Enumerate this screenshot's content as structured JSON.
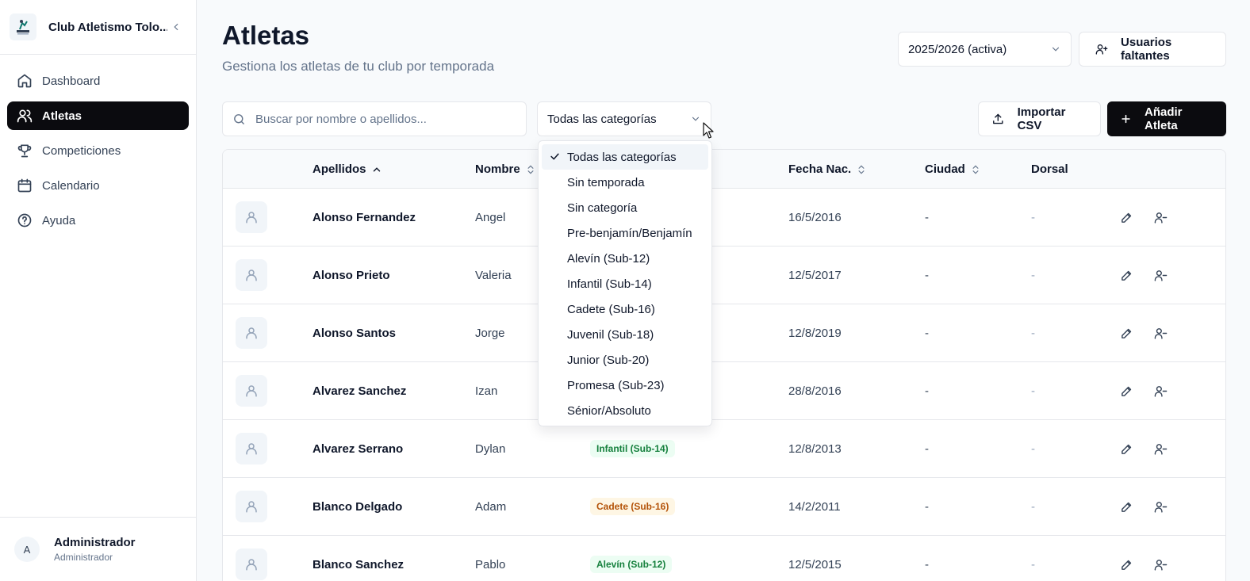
{
  "sidebar": {
    "club_name": "Club Atletismo Tolo...",
    "nav": [
      {
        "label": "Dashboard",
        "icon": "home-icon",
        "active": false
      },
      {
        "label": "Atletas",
        "icon": "users-icon",
        "active": true
      },
      {
        "label": "Competiciones",
        "icon": "trophy-icon",
        "active": false
      },
      {
        "label": "Calendario",
        "icon": "calendar-icon",
        "active": false
      },
      {
        "label": "Ayuda",
        "icon": "help-circle-icon",
        "active": false
      }
    ],
    "user": {
      "initial": "A",
      "name": "Administrador",
      "role": "Administrador"
    }
  },
  "header": {
    "title": "Atletas",
    "subtitle": "Gestiona los atletas de tu club por temporada",
    "season_value": "2025/2026 (activa)",
    "missing_users_label": "Usuarios faltantes"
  },
  "toolbar": {
    "search_placeholder": "Buscar por nombre o apellidos...",
    "category_value": "Todas las categorías",
    "import_label": "Importar CSV",
    "add_label": "Añadir Atleta"
  },
  "table": {
    "columns": {
      "lastname": "Apellidos",
      "name": "Nombre",
      "birth": "Fecha Nac.",
      "city": "Ciudad",
      "dorsal": "Dorsal"
    },
    "rows": [
      {
        "lastname": "Alonso Fernandez",
        "name": "Angel",
        "category": "",
        "birth": "16/5/2016",
        "city": "-",
        "dorsal": "-"
      },
      {
        "lastname": "Alonso Prieto",
        "name": "Valeria",
        "category": "",
        "birth": "12/5/2017",
        "city": "-",
        "dorsal": "-"
      },
      {
        "lastname": "Alonso Santos",
        "name": "Jorge",
        "category": "",
        "birth": "12/8/2019",
        "city": "-",
        "dorsal": "-"
      },
      {
        "lastname": "Alvarez Sanchez",
        "name": "Izan",
        "category": "",
        "birth": "28/8/2016",
        "city": "-",
        "dorsal": "-"
      },
      {
        "lastname": "Alvarez Serrano",
        "name": "Dylan",
        "category": "Infantil (Sub-14)",
        "category_color": "#15803d",
        "category_bg": "#ecfdf3",
        "birth": "12/8/2013",
        "city": "-",
        "dorsal": "-"
      },
      {
        "lastname": "Blanco Delgado",
        "name": "Adam",
        "category": "Cadete (Sub-16)",
        "category_color": "#b45309",
        "category_bg": "#fef6e4",
        "birth": "14/2/2011",
        "city": "-",
        "dorsal": "-"
      },
      {
        "lastname": "Blanco Sanchez",
        "name": "Pablo",
        "category": "Alevín (Sub-12)",
        "category_color": "#15803d",
        "category_bg": "#ecfdf3",
        "birth": "12/5/2015",
        "city": "-",
        "dorsal": "-"
      }
    ]
  },
  "dropdown": {
    "options": [
      {
        "label": "Todas las categorías",
        "selected": true
      },
      {
        "label": "Sin temporada",
        "selected": false
      },
      {
        "label": "Sin categoría",
        "selected": false
      },
      {
        "label": "Pre-benjamín/Benjamín",
        "selected": false
      },
      {
        "label": "Alevín (Sub-12)",
        "selected": false
      },
      {
        "label": "Infantil (Sub-14)",
        "selected": false
      },
      {
        "label": "Cadete (Sub-16)",
        "selected": false
      },
      {
        "label": "Juvenil (Sub-18)",
        "selected": false
      },
      {
        "label": "Junior (Sub-20)",
        "selected": false
      },
      {
        "label": "Promesa (Sub-23)",
        "selected": false
      },
      {
        "label": "Sénior/Absoluto",
        "selected": false
      }
    ]
  },
  "colors": {
    "accent": "#0b0b0f",
    "border": "#e5e7eb",
    "muted": "#64748b"
  }
}
